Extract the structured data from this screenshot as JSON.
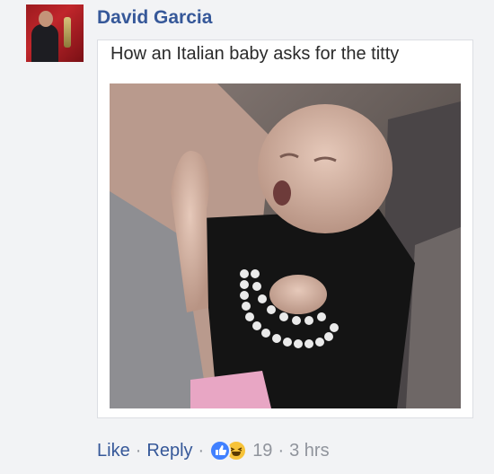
{
  "comment": {
    "author": "David Garcia",
    "avatar_icon": "user-avatar",
    "post": {
      "caption": "How an Italian baby asks for the titty",
      "image_icon": "baby-photo"
    },
    "actions": {
      "like_label": "Like",
      "reply_label": "Reply",
      "reactions": [
        "like-icon",
        "haha-icon"
      ],
      "reaction_count": "19",
      "timestamp": "3 hrs",
      "separator": "·"
    }
  },
  "colors": {
    "link": "#365899",
    "meta": "#90949c",
    "background": "#f2f3f5",
    "like_blue": "#4080ff",
    "haha_yellow": "#f7c339"
  }
}
